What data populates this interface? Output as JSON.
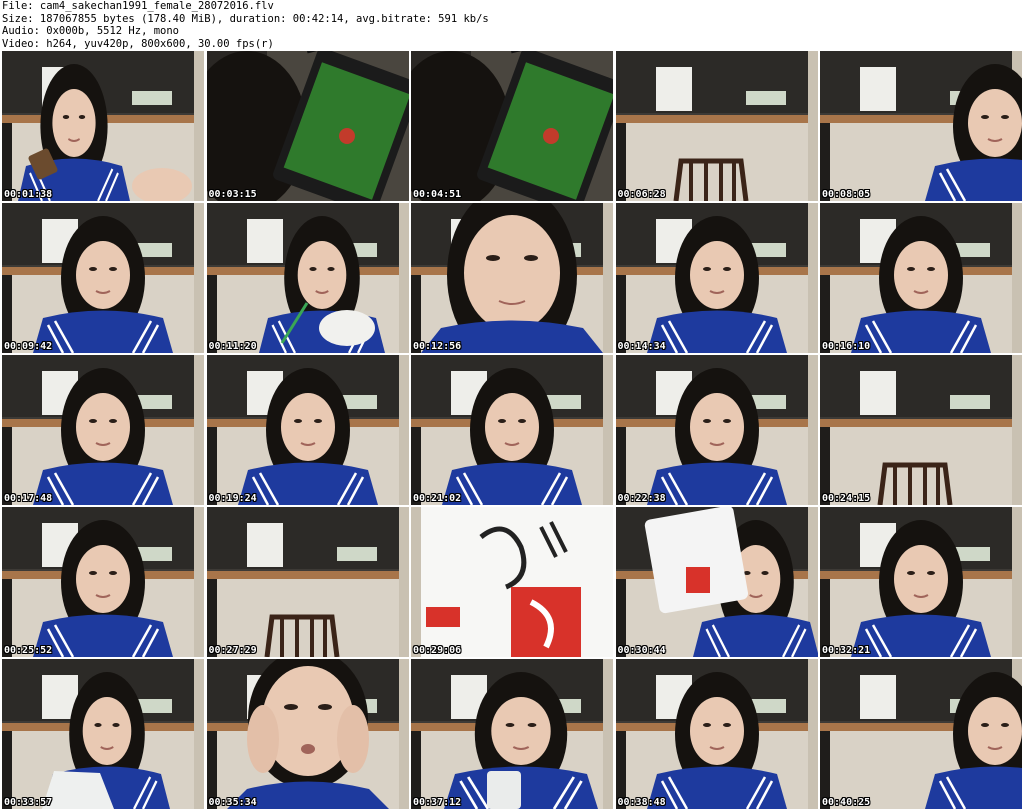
{
  "header": {
    "file": "File: cam4_sakechan1991_female_28072016.flv",
    "size": "Size: 187067855 bytes (178.40 MiB), duration: 00:42:14, avg.bitrate: 591 kb/s",
    "audio": "Audio: 0x000b, 5512 Hz, mono",
    "video": "Video: h264, yuv420p, 800x600, 30.00 fps(r)"
  },
  "colors": {
    "wall": "#3d3a36",
    "counter": "#d9d2c6",
    "jersey": "#1e3a9e",
    "hair": "#15120f",
    "skin": "#e9c9b3"
  },
  "thumbnails": [
    {
      "timestamp": "00:01:38",
      "scene": "person-phone"
    },
    {
      "timestamp": "00:03:15",
      "scene": "tablet-closeup"
    },
    {
      "timestamp": "00:04:51",
      "scene": "tablet-closeup"
    },
    {
      "timestamp": "00:06:28",
      "scene": "empty-room"
    },
    {
      "timestamp": "00:08:05",
      "scene": "person-edge"
    },
    {
      "timestamp": "00:09:42",
      "scene": "person"
    },
    {
      "timestamp": "00:11:20",
      "scene": "person-bowl"
    },
    {
      "timestamp": "00:12:56",
      "scene": "face-closeup"
    },
    {
      "timestamp": "00:14:34",
      "scene": "person"
    },
    {
      "timestamp": "00:16:10",
      "scene": "person"
    },
    {
      "timestamp": "00:17:48",
      "scene": "person"
    },
    {
      "timestamp": "00:19:24",
      "scene": "person"
    },
    {
      "timestamp": "00:21:02",
      "scene": "person"
    },
    {
      "timestamp": "00:22:38",
      "scene": "person"
    },
    {
      "timestamp": "00:24:15",
      "scene": "empty-room"
    },
    {
      "timestamp": "00:25:52",
      "scene": "person"
    },
    {
      "timestamp": "00:27:29",
      "scene": "empty-room"
    },
    {
      "timestamp": "00:29:06",
      "scene": "package-closeup"
    },
    {
      "timestamp": "00:30:44",
      "scene": "person-package"
    },
    {
      "timestamp": "00:32:21",
      "scene": "person"
    },
    {
      "timestamp": "00:33:57",
      "scene": "person-bag"
    },
    {
      "timestamp": "00:35:34",
      "scene": "face-hands"
    },
    {
      "timestamp": "00:37:12",
      "scene": "face-cup"
    },
    {
      "timestamp": "00:38:48",
      "scene": "person"
    },
    {
      "timestamp": "00:40:25",
      "scene": "person-edge"
    }
  ]
}
